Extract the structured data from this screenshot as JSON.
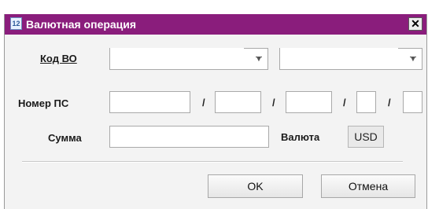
{
  "window": {
    "title": "Валютная операция",
    "icon": "app-icon",
    "icon_glyph": "12",
    "close_glyph": "✕",
    "accent_color": "#8a1d7c"
  },
  "form": {
    "kod_vo_label": "Код ВО",
    "kod_vo_value": "",
    "kod_vo_second_value": "",
    "nomer_ps_label": "Номер ПС",
    "nomer_ps_parts": [
      "",
      "",
      "",
      "",
      ""
    ],
    "separator": "/",
    "summa_label": "Сумма",
    "summa_value": "",
    "valyuta_label": "Валюта",
    "valyuta_value": "USD"
  },
  "buttons": {
    "ok_label": "OK",
    "cancel_label": "Отмена"
  }
}
